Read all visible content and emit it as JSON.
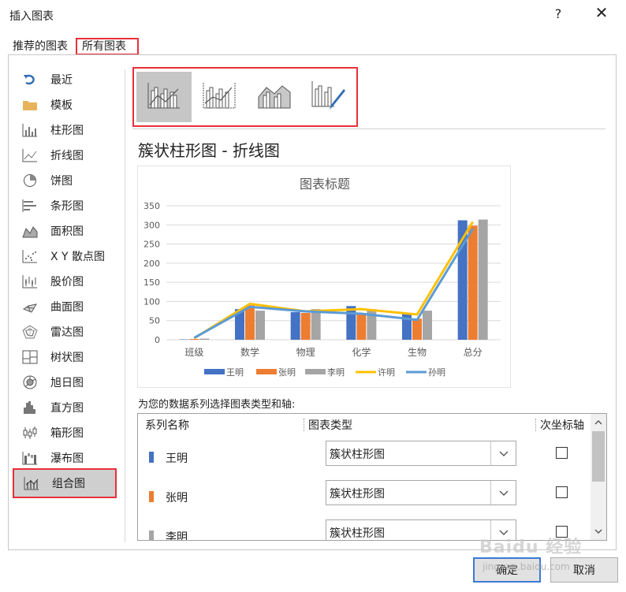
{
  "window": {
    "title": "插入图表",
    "help": "?",
    "close": "✕"
  },
  "tabs": {
    "recommended": "推荐的图表",
    "all": "所有图表"
  },
  "sidebar": {
    "items": [
      {
        "label": "最近",
        "icon": "recent-icon"
      },
      {
        "label": "模板",
        "icon": "folder-icon"
      },
      {
        "label": "柱形图",
        "icon": "column-chart-icon"
      },
      {
        "label": "折线图",
        "icon": "line-chart-icon"
      },
      {
        "label": "饼图",
        "icon": "pie-chart-icon"
      },
      {
        "label": "条形图",
        "icon": "bar-chart-icon"
      },
      {
        "label": "面积图",
        "icon": "area-chart-icon"
      },
      {
        "label": "X Y 散点图",
        "icon": "scatter-chart-icon"
      },
      {
        "label": "股价图",
        "icon": "stock-chart-icon"
      },
      {
        "label": "曲面图",
        "icon": "surface-chart-icon"
      },
      {
        "label": "雷达图",
        "icon": "radar-chart-icon"
      },
      {
        "label": "树状图",
        "icon": "treemap-chart-icon"
      },
      {
        "label": "旭日图",
        "icon": "sunburst-chart-icon"
      },
      {
        "label": "直方图",
        "icon": "histogram-chart-icon"
      },
      {
        "label": "箱形图",
        "icon": "boxplot-chart-icon"
      },
      {
        "label": "瀑布图",
        "icon": "waterfall-chart-icon"
      },
      {
        "label": "组合图",
        "icon": "combo-chart-icon"
      }
    ],
    "selected_index": 16
  },
  "subtypes": [
    {
      "icon": "clustered-column-line-icon",
      "selected": true
    },
    {
      "icon": "clustered-column-line-secondary-axis-icon",
      "selected": false
    },
    {
      "icon": "stacked-area-clustered-column-icon",
      "selected": false
    },
    {
      "icon": "custom-combination-icon",
      "selected": false
    }
  ],
  "preview": {
    "heading": "簇状柱形图 - 折线图"
  },
  "chart_data": {
    "type": "bar",
    "title": "图表标题",
    "categories": [
      "班级",
      "数学",
      "物理",
      "化学",
      "生物",
      "总分"
    ],
    "ylim": [
      0,
      350
    ],
    "yticks": [
      0,
      50,
      100,
      150,
      200,
      250,
      300,
      350
    ],
    "grid": true,
    "legend_position": "bottom",
    "series": [
      {
        "name": "王明",
        "kind": "bar",
        "color": "#4472c4",
        "values": [
          1,
          80,
          72,
          88,
          68,
          312
        ]
      },
      {
        "name": "张明",
        "kind": "bar",
        "color": "#ed7d31",
        "values": [
          2,
          90,
          70,
          68,
          55,
          298
        ]
      },
      {
        "name": "李明",
        "kind": "bar",
        "color": "#a5a5a5",
        "values": [
          3,
          76,
          80,
          80,
          76,
          314
        ]
      },
      {
        "name": "许明",
        "kind": "line",
        "color": "#ffc000",
        "values": [
          4,
          94,
          74,
          80,
          66,
          308
        ]
      },
      {
        "name": "孙明",
        "kind": "line",
        "color": "#5b9bd5",
        "values": [
          5,
          86,
          74,
          68,
          52,
          290
        ]
      }
    ]
  },
  "series_table": {
    "prompt": "为您的数据系列选择图表类型和轴:",
    "headers": {
      "name": "系列名称",
      "type": "图表类型",
      "secondary": "次坐标轴"
    },
    "rows": [
      {
        "name": "王明",
        "color": "#4472c4",
        "type": "簇状柱形图",
        "secondary": false
      },
      {
        "name": "张明",
        "color": "#ed7d31",
        "type": "簇状柱形图",
        "secondary": false
      },
      {
        "name": "李明",
        "color": "#a5a5a5",
        "type": "簇状柱形图",
        "secondary": false
      }
    ]
  },
  "buttons": {
    "ok": "确定",
    "cancel": "取消"
  },
  "watermark": {
    "brand": "Baidu 经验",
    "url": "jingyan.baidu.com"
  }
}
